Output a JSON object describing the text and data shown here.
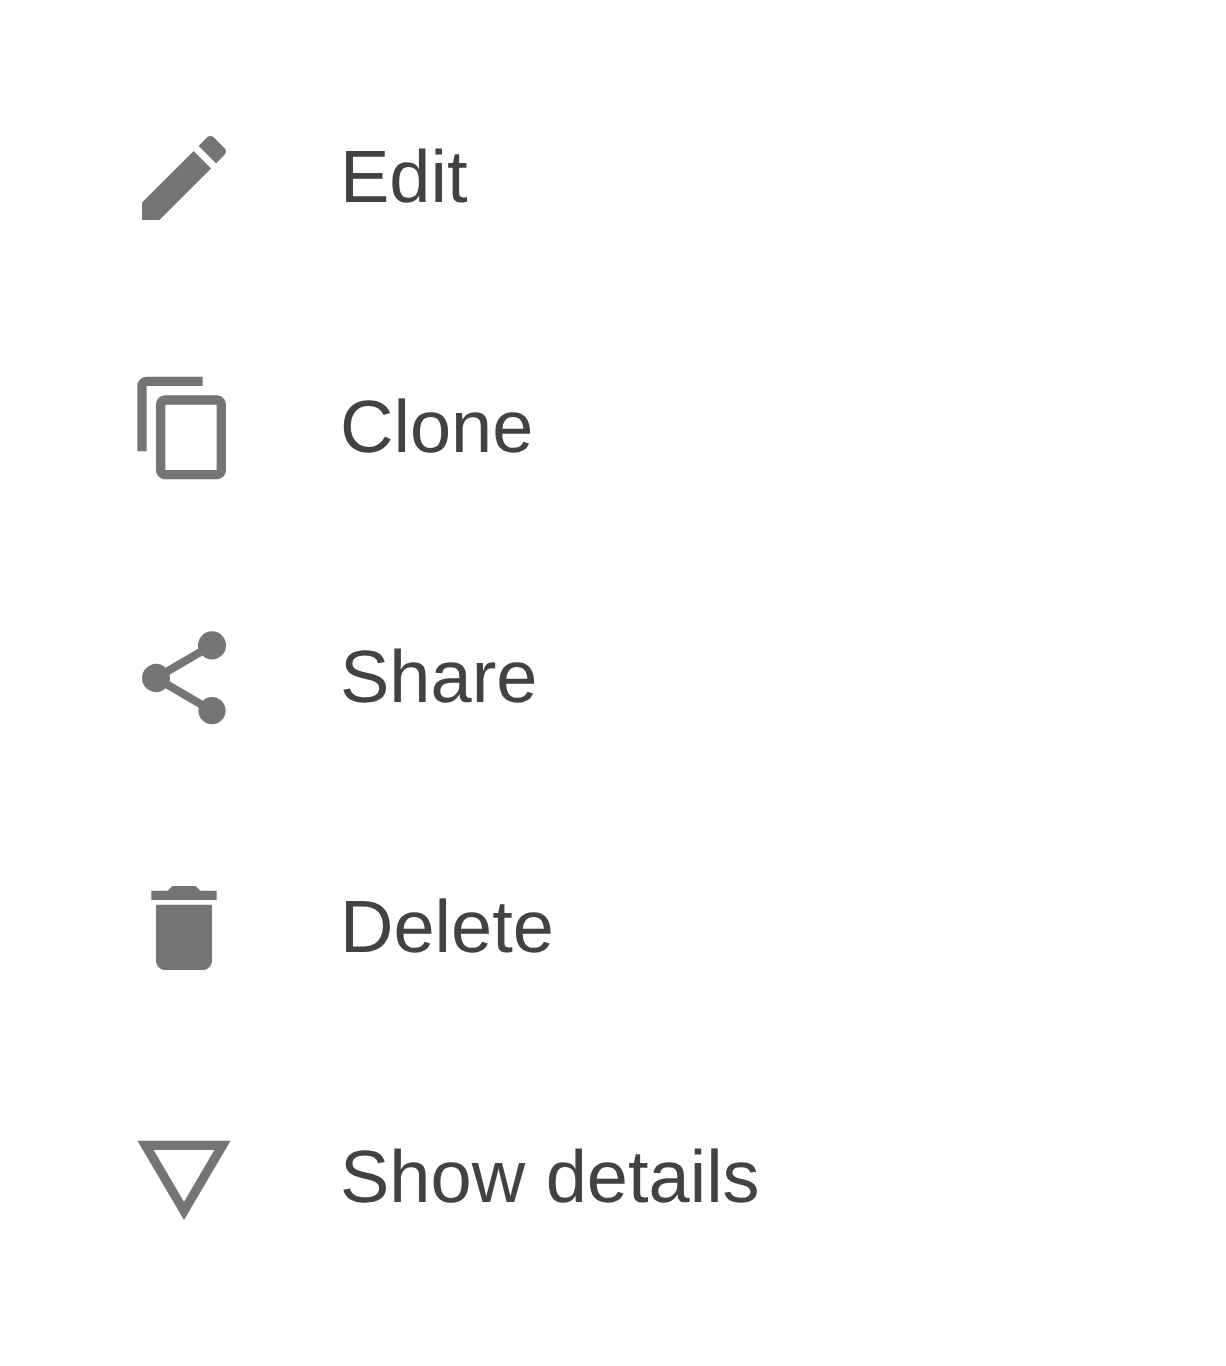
{
  "menu": {
    "items": [
      {
        "label": "Edit"
      },
      {
        "label": "Clone"
      },
      {
        "label": "Share"
      },
      {
        "label": "Delete"
      },
      {
        "label": "Show details"
      }
    ]
  }
}
